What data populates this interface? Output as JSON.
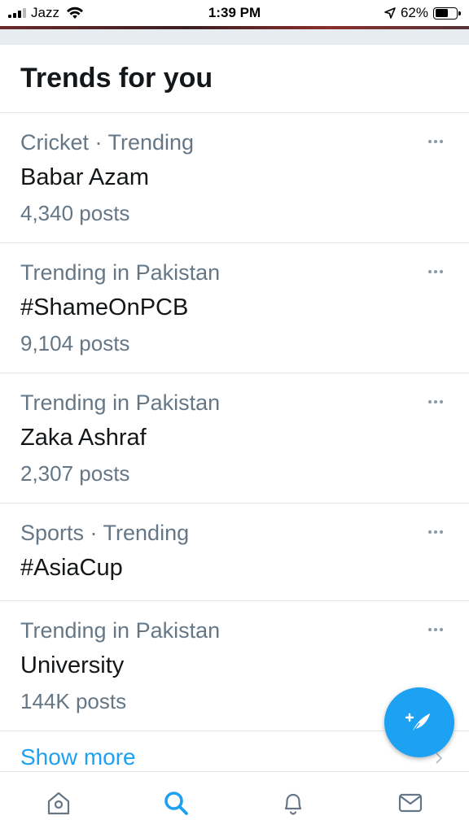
{
  "status_bar": {
    "carrier": "Jazz",
    "time": "1:39 PM",
    "battery_percent": "62%",
    "battery_level": 0.62
  },
  "trends": {
    "title": "Trends for you",
    "items": [
      {
        "context": "Cricket · Trending",
        "name": "Babar Azam",
        "count": "4,340 posts"
      },
      {
        "context": "Trending in Pakistan",
        "name": "#ShameOnPCB",
        "count": "9,104 posts"
      },
      {
        "context": "Trending in Pakistan",
        "name": "Zaka Ashraf",
        "count": "2,307 posts"
      },
      {
        "context": "Sports · Trending",
        "name": "#AsiaCup",
        "count": ""
      },
      {
        "context": "Trending in Pakistan",
        "name": "University",
        "count": "144K posts"
      }
    ],
    "show_more": "Show more"
  },
  "tabs": [
    {
      "name": "home-tab",
      "icon": "home-icon",
      "active": false
    },
    {
      "name": "search-tab",
      "icon": "search-icon",
      "active": true
    },
    {
      "name": "notifications-tab",
      "icon": "bell-icon",
      "active": false
    },
    {
      "name": "messages-tab",
      "icon": "mail-icon",
      "active": false
    }
  ],
  "colors": {
    "accent": "#1da1f2",
    "secondary_text": "#657786",
    "primary_text": "#14171a",
    "inactive_icon": "#657786"
  }
}
